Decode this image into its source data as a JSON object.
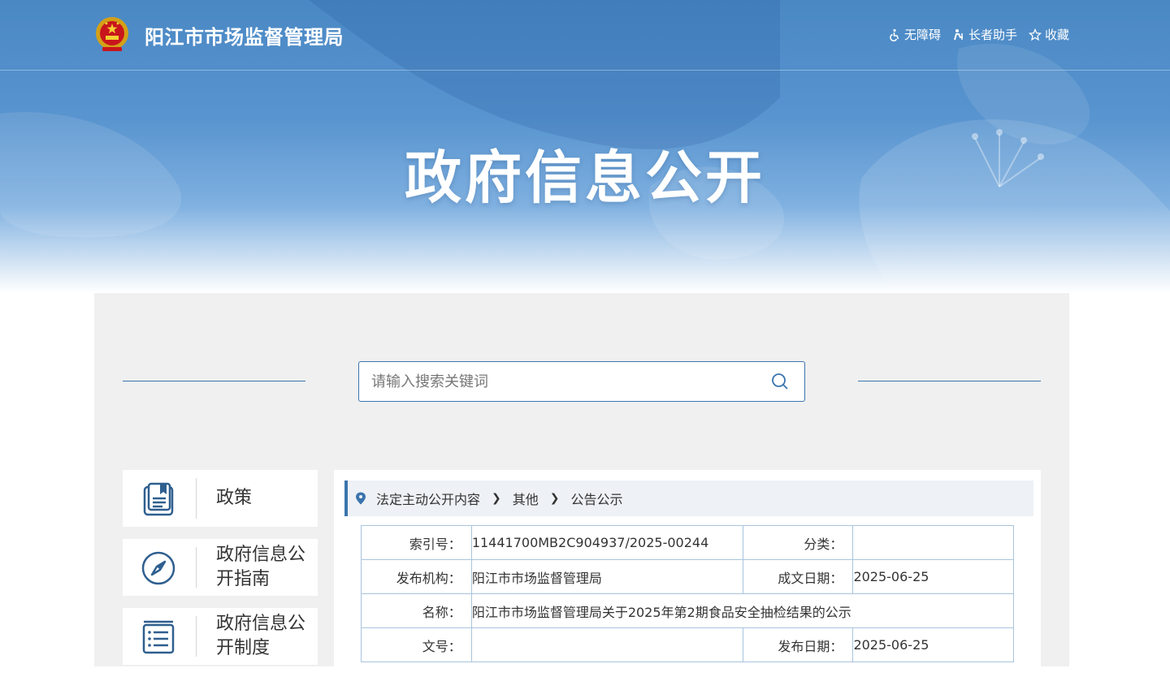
{
  "header": {
    "site_title": "阳江市市场监督管理局",
    "tools": [
      {
        "label": "无障碍",
        "icon": "wheelchair-icon"
      },
      {
        "label": "长者助手",
        "icon": "elder-helper-icon"
      },
      {
        "label": "收藏",
        "icon": "star-icon"
      }
    ]
  },
  "hero": {
    "title": "政府信息公开"
  },
  "search": {
    "placeholder": "请输入搜索关键词"
  },
  "sidebar": {
    "items": [
      {
        "label": "政策",
        "icon": "book-icon"
      },
      {
        "label": "政府信息公开指南",
        "icon": "compass-icon"
      },
      {
        "label": "政府信息公开制度",
        "icon": "list-document-icon"
      }
    ]
  },
  "breadcrumb": [
    "法定主动公开内容",
    "其他",
    "公告公示"
  ],
  "meta": {
    "index_label": "索引号：",
    "index_value": "11441700MB2C904937/2025-00244",
    "category_label": "分类：",
    "category_value": "",
    "publisher_label": "发布机构：",
    "publisher_value": "阳江市市场监督管理局",
    "written_date_label": "成文日期：",
    "written_date_value": "2025-06-25",
    "name_label": "名称：",
    "name_value": "阳江市市场监督管理局关于2025年第2期食品安全抽检结果的公示",
    "doc_no_label": "文号：",
    "doc_no_value": "",
    "publish_date_label": "发布日期：",
    "publish_date_value": "2025-06-25"
  },
  "colors": {
    "accent": "#3b74ad",
    "banner_top": "#4a88c4",
    "panel_bg": "#f0f0f0",
    "table_border": "#a8c4de"
  }
}
